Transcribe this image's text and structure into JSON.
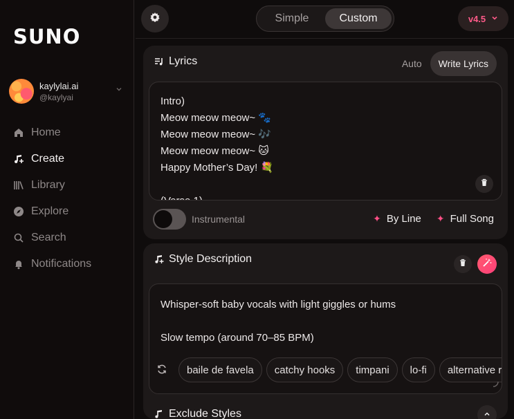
{
  "brand": {
    "logo": "SUNO"
  },
  "profile": {
    "name": "kaylylai.ai",
    "handle": "@kaylyai"
  },
  "nav": {
    "items": [
      {
        "label": "Home",
        "icon": "home-icon",
        "active": false
      },
      {
        "label": "Create",
        "icon": "music-note-icon",
        "active": true
      },
      {
        "label": "Library",
        "icon": "library-icon",
        "active": false
      },
      {
        "label": "Explore",
        "icon": "compass-icon",
        "active": false
      },
      {
        "label": "Search",
        "icon": "search-icon",
        "active": false
      },
      {
        "label": "Notifications",
        "icon": "bell-icon",
        "active": false
      }
    ]
  },
  "topbar": {
    "mode_simple": "Simple",
    "mode_custom": "Custom",
    "version": "v4.5"
  },
  "lyrics": {
    "title": "Lyrics",
    "tab_auto": "Auto",
    "tab_write": "Write Lyrics",
    "lines": [
      "Intro)",
      "Meow meow meow~ 🐾",
      "Meow meow meow~ 🎶",
      "Meow meow meow~ 🐱",
      "Happy Mother’s Day! 💐",
      "",
      "(Verse 1)"
    ],
    "instrumental_label": "Instrumental",
    "by_line": "By Line",
    "full_song": "Full Song"
  },
  "style": {
    "title": "Style Description",
    "line1": "Whisper-soft baby vocals with light giggles or hums",
    "line2": "Slow tempo (around 70–85 BPM)",
    "tags": [
      "baile de favela",
      "catchy hooks",
      "timpani",
      "lo-fi",
      "alternative rock"
    ]
  },
  "exclude": {
    "title": "Exclude Styles"
  },
  "colors": {
    "accent": "#ff4f86",
    "background": "#0f0c0c",
    "panel": "#1d1919"
  }
}
